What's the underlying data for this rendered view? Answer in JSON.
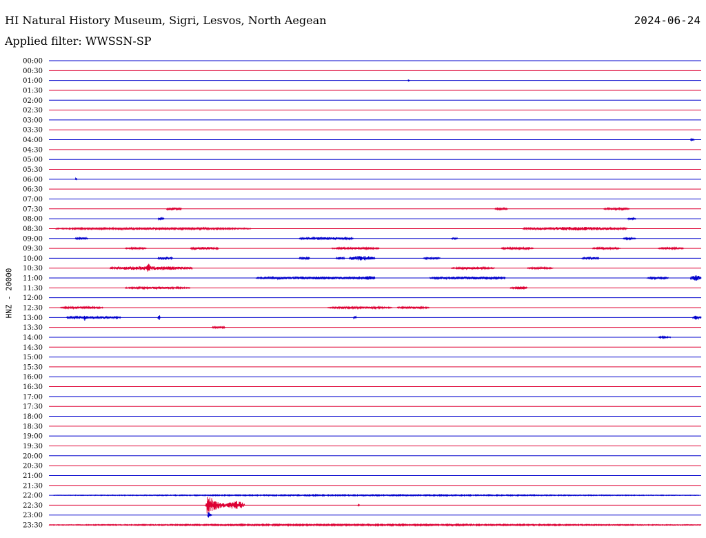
{
  "header": {
    "title": "HI Natural History Museum, Sigri, Lesvos, North Aegean",
    "date": "2024-06-24",
    "filter": "Applied filter: WWSSN-SP"
  },
  "colors": {
    "even_row": "#0000cc",
    "odd_row": "#dd0033",
    "background": "#ffffff"
  },
  "chart_data": {
    "type": "line",
    "ylabel": "HNZ - 20000",
    "row_labels": [
      "00:00",
      "00:30",
      "01:00",
      "01:30",
      "02:00",
      "02:30",
      "03:00",
      "03:30",
      "04:00",
      "04:30",
      "05:00",
      "05:30",
      "06:00",
      "06:30",
      "07:00",
      "07:30",
      "08:00",
      "08:30",
      "09:00",
      "09:30",
      "10:00",
      "10:30",
      "11:00",
      "11:30",
      "12:00",
      "12:30",
      "13:00",
      "13:30",
      "14:00",
      "14:30",
      "15:00",
      "15:30",
      "16:00",
      "16:30",
      "17:00",
      "17:30",
      "18:00",
      "18:30",
      "19:00",
      "19:30",
      "20:00",
      "20:30",
      "21:00",
      "21:30",
      "22:00",
      "22:30",
      "23:00",
      "23:30"
    ],
    "row_minutes": 30,
    "events": [
      {
        "row": 2,
        "start_min": 16.5,
        "dur_min": 0.1,
        "amp": 1.5
      },
      {
        "row": 8,
        "start_min": 29.5,
        "dur_min": 0.2,
        "amp": 1.5
      },
      {
        "row": 12,
        "start_min": 1.2,
        "dur_min": 0.1,
        "amp": 1.5
      },
      {
        "row": 15,
        "start_min": 5.4,
        "dur_min": 0.7,
        "amp": 2.5
      },
      {
        "row": 15,
        "start_min": 20.5,
        "dur_min": 0.6,
        "amp": 1.5
      },
      {
        "row": 15,
        "start_min": 25.5,
        "dur_min": 1.2,
        "amp": 1.5
      },
      {
        "row": 16,
        "start_min": 5.0,
        "dur_min": 0.3,
        "amp": 1.5
      },
      {
        "row": 16,
        "start_min": 26.6,
        "dur_min": 0.4,
        "amp": 1.5
      },
      {
        "row": 17,
        "start_min": 0.3,
        "dur_min": 9.0,
        "amp": 1.5
      },
      {
        "row": 17,
        "start_min": 21.8,
        "dur_min": 4.8,
        "amp": 2.5
      },
      {
        "row": 18,
        "start_min": 1.2,
        "dur_min": 0.6,
        "amp": 1.5
      },
      {
        "row": 18,
        "start_min": 11.5,
        "dur_min": 2.5,
        "amp": 2.0
      },
      {
        "row": 18,
        "start_min": 18.5,
        "dur_min": 0.3,
        "amp": 1.2
      },
      {
        "row": 18,
        "start_min": 26.4,
        "dur_min": 0.6,
        "amp": 1.2
      },
      {
        "row": 19,
        "start_min": 3.5,
        "dur_min": 1.0,
        "amp": 1.2
      },
      {
        "row": 19,
        "start_min": 6.5,
        "dur_min": 1.3,
        "amp": 2.0
      },
      {
        "row": 19,
        "start_min": 13.0,
        "dur_min": 2.2,
        "amp": 1.5
      },
      {
        "row": 19,
        "start_min": 20.8,
        "dur_min": 1.5,
        "amp": 1.5
      },
      {
        "row": 19,
        "start_min": 25.0,
        "dur_min": 1.3,
        "amp": 1.5
      },
      {
        "row": 19,
        "start_min": 28.0,
        "dur_min": 1.2,
        "amp": 1.2
      },
      {
        "row": 20,
        "start_min": 5.0,
        "dur_min": 0.7,
        "amp": 2.5
      },
      {
        "row": 20,
        "start_min": 11.5,
        "dur_min": 0.5,
        "amp": 1.5
      },
      {
        "row": 20,
        "start_min": 13.2,
        "dur_min": 0.4,
        "amp": 2.0
      },
      {
        "row": 20,
        "start_min": 13.8,
        "dur_min": 1.2,
        "amp": 3.5
      },
      {
        "row": 20,
        "start_min": 17.2,
        "dur_min": 0.8,
        "amp": 1.5
      },
      {
        "row": 20,
        "start_min": 24.5,
        "dur_min": 0.8,
        "amp": 2.0
      },
      {
        "row": 21,
        "start_min": 2.8,
        "dur_min": 3.8,
        "amp": 3.0
      },
      {
        "row": 21,
        "start_min": 4.5,
        "dur_min": 0.15,
        "amp": 8.0
      },
      {
        "row": 21,
        "start_min": 18.5,
        "dur_min": 2.0,
        "amp": 1.5
      },
      {
        "row": 21,
        "start_min": 22.0,
        "dur_min": 1.2,
        "amp": 1.2
      },
      {
        "row": 22,
        "start_min": 9.5,
        "dur_min": 5.5,
        "amp": 2.0
      },
      {
        "row": 22,
        "start_min": 14.5,
        "dur_min": 0.5,
        "amp": 3.0
      },
      {
        "row": 22,
        "start_min": 17.5,
        "dur_min": 3.5,
        "amp": 2.0
      },
      {
        "row": 22,
        "start_min": 20.5,
        "dur_min": 0.4,
        "amp": 1.5
      },
      {
        "row": 22,
        "start_min": 27.5,
        "dur_min": 1.0,
        "amp": 1.5
      },
      {
        "row": 22,
        "start_min": 29.5,
        "dur_min": 0.5,
        "amp": 4.0
      },
      {
        "row": 23,
        "start_min": 3.5,
        "dur_min": 3.0,
        "amp": 1.5
      },
      {
        "row": 23,
        "start_min": 21.2,
        "dur_min": 0.8,
        "amp": 1.5
      },
      {
        "row": 23,
        "start_min": 21.5,
        "dur_min": 0.5,
        "amp": 2.0
      },
      {
        "row": 25,
        "start_min": 0.5,
        "dur_min": 2.0,
        "amp": 1.5
      },
      {
        "row": 25,
        "start_min": 12.8,
        "dur_min": 3.0,
        "amp": 1.5
      },
      {
        "row": 25,
        "start_min": 16.0,
        "dur_min": 1.5,
        "amp": 1.5
      },
      {
        "row": 26,
        "start_min": 0.8,
        "dur_min": 2.5,
        "amp": 2.0
      },
      {
        "row": 26,
        "start_min": 1.6,
        "dur_min": 0.12,
        "amp": 5.0
      },
      {
        "row": 26,
        "start_min": 5.0,
        "dur_min": 0.12,
        "amp": 5.0
      },
      {
        "row": 26,
        "start_min": 14.0,
        "dur_min": 0.15,
        "amp": 2.0
      },
      {
        "row": 26,
        "start_min": 29.6,
        "dur_min": 0.4,
        "amp": 3.5
      },
      {
        "row": 27,
        "start_min": 7.5,
        "dur_min": 0.6,
        "amp": 1.5
      },
      {
        "row": 28,
        "start_min": 28.0,
        "dur_min": 0.6,
        "amp": 1.2
      },
      {
        "row": 44,
        "start_min": 0.2,
        "dur_min": 29.7,
        "amp": 0.8
      },
      {
        "row": 45,
        "start_min": 7.2,
        "dur_min": 1.5,
        "amp": 18.0
      },
      {
        "row": 45,
        "start_min": 8.2,
        "dur_min": 0.8,
        "amp": 6.0
      },
      {
        "row": 45,
        "start_min": 14.2,
        "dur_min": 0.1,
        "amp": 1.5
      },
      {
        "row": 46,
        "start_min": 7.3,
        "dur_min": 0.2,
        "amp": 10.0
      },
      {
        "row": 47,
        "start_min": 0.0,
        "dur_min": 30.0,
        "amp": 1.0
      }
    ]
  }
}
